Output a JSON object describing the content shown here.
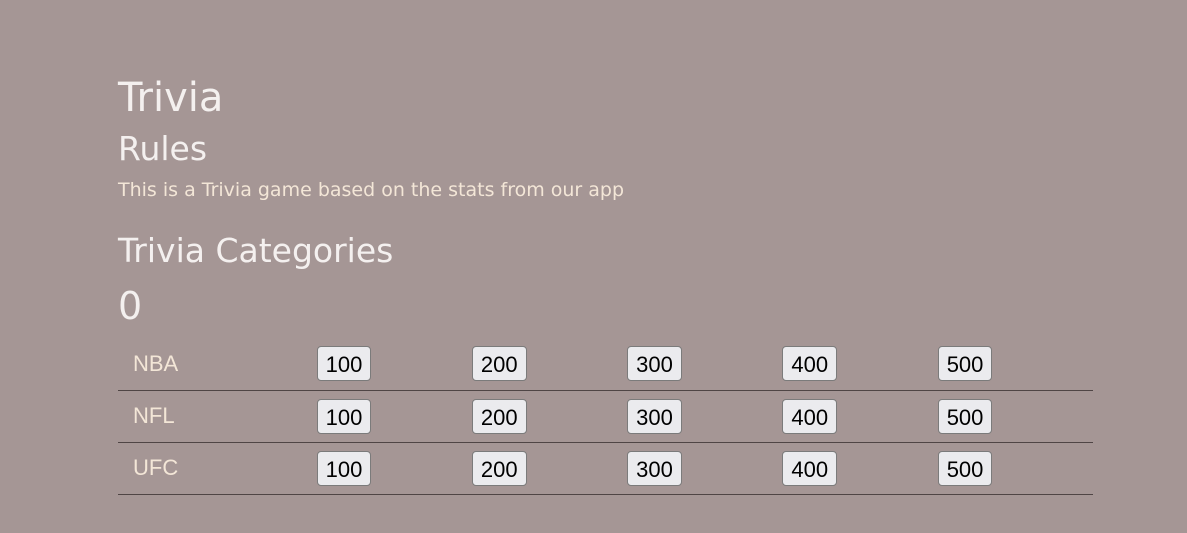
{
  "app": {
    "title": "Trivia"
  },
  "rules": {
    "title": "Rules",
    "text": "This is a Trivia game based on the stats from our app"
  },
  "categories": {
    "title": "Trivia Categories",
    "score": "0",
    "rows": [
      {
        "name": "NBA",
        "values": [
          "100",
          "200",
          "300",
          "400",
          "500"
        ]
      },
      {
        "name": "NFL",
        "values": [
          "100",
          "200",
          "300",
          "400",
          "500"
        ]
      },
      {
        "name": "UFC",
        "values": [
          "100",
          "200",
          "300",
          "400",
          "500"
        ]
      }
    ]
  }
}
